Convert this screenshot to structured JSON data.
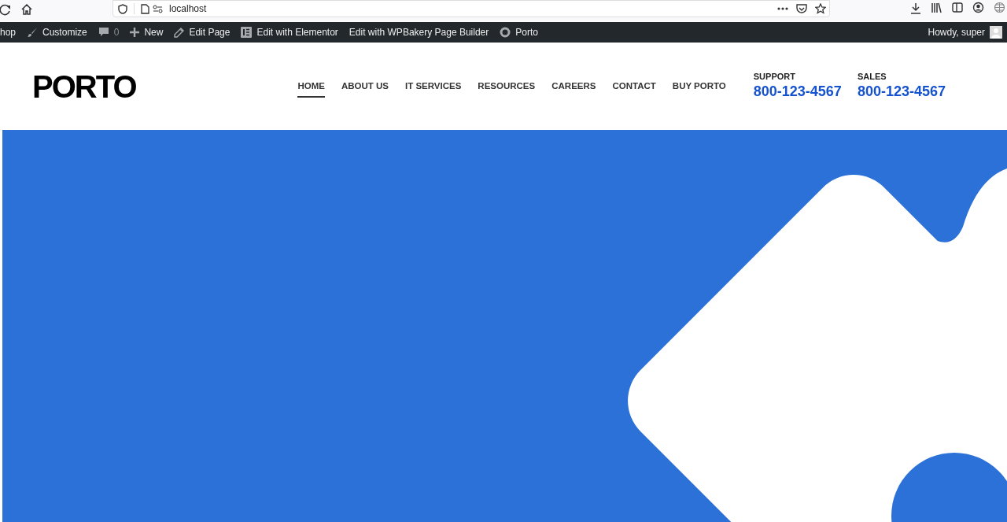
{
  "browser": {
    "url": "localhost"
  },
  "admin_bar": {
    "items": [
      {
        "kind": "text",
        "label": "hop"
      },
      {
        "kind": "brush",
        "label": "Customize"
      },
      {
        "kind": "comment",
        "label": "0"
      },
      {
        "kind": "plus",
        "label": "New"
      },
      {
        "kind": "pencil",
        "label": "Edit Page"
      },
      {
        "kind": "elementor",
        "label": "Edit with Elementor"
      },
      {
        "kind": "text",
        "label": "Edit with WPBakery Page Builder"
      },
      {
        "kind": "ring",
        "label": "Porto"
      }
    ],
    "greeting": "Howdy, super"
  },
  "header": {
    "logo": "PORTO",
    "nav": [
      {
        "label": "HOME",
        "selected": true
      },
      {
        "label": "ABOUT US",
        "selected": false
      },
      {
        "label": "IT SERVICES",
        "selected": false
      },
      {
        "label": "RESOURCES",
        "selected": false
      },
      {
        "label": "CAREERS",
        "selected": false
      },
      {
        "label": "CONTACT",
        "selected": false
      },
      {
        "label": "BUY PORTO",
        "selected": false
      }
    ],
    "contacts": [
      {
        "label": "SUPPORT",
        "phone": "800-123-4567"
      },
      {
        "label": "SALES",
        "phone": "800-123-4567"
      }
    ]
  }
}
